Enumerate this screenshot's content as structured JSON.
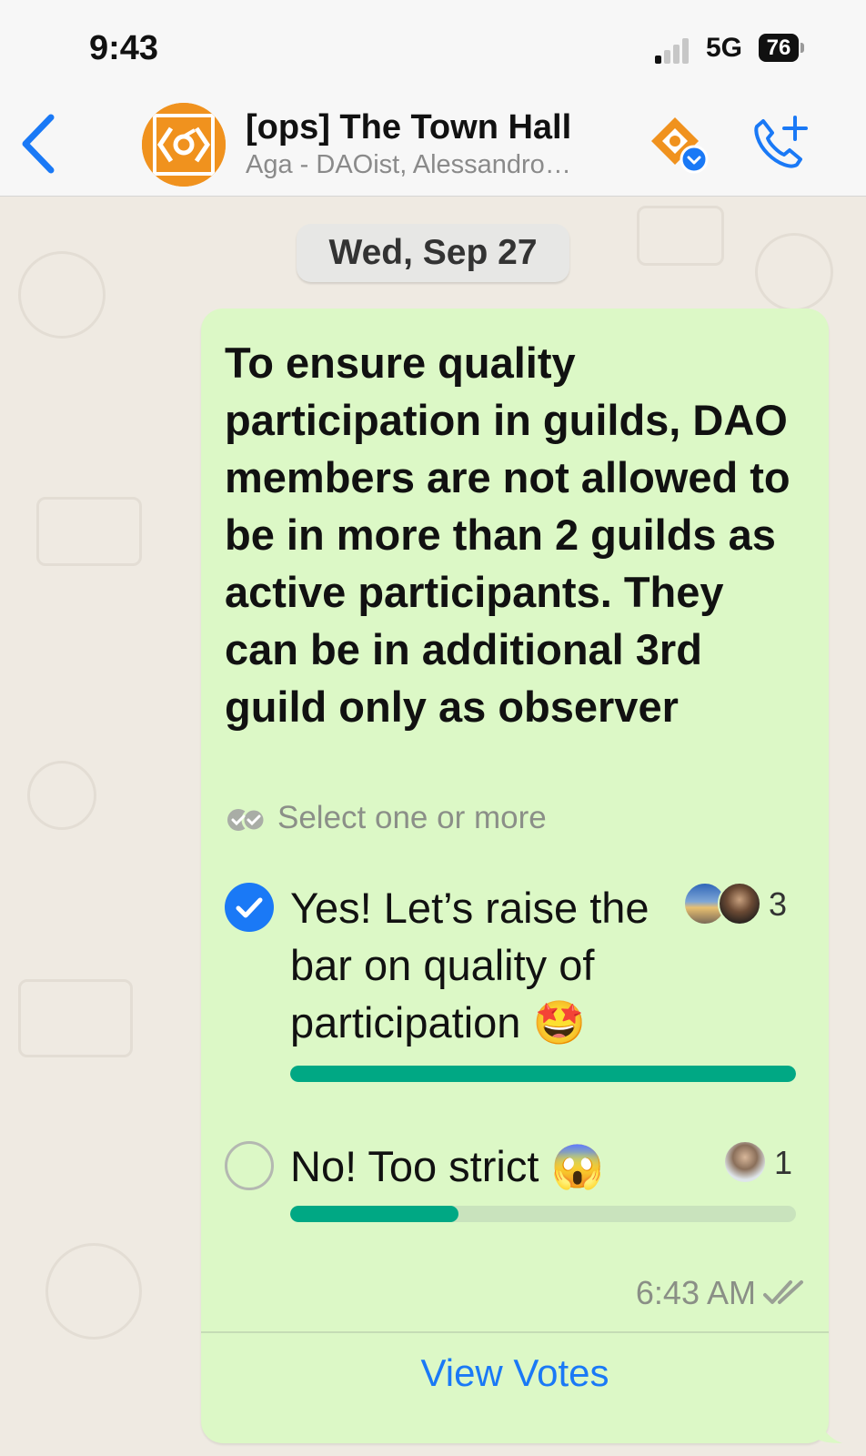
{
  "status_bar": {
    "time": "9:43",
    "network": "5G",
    "battery": "76"
  },
  "header": {
    "title": "[ops] The Town Hall",
    "subtitle": "Aga - DAOist, Alessandro…",
    "icons": [
      "back-chevron-icon",
      "group-avatar",
      "community-icon",
      "add-call-icon"
    ]
  },
  "chat": {
    "date_label": "Wed, Sep 27",
    "poll": {
      "question": "To ensure quality participation in guilds, DAO members are not allowed to be in more than 2 guilds as active participants. They can be in additional 3rd guild only as observer",
      "select_hint": "Select one or more",
      "options": [
        {
          "text": "Yes! Let’s raise the bar on quality of participation 🤩",
          "votes": "3",
          "fraction": 1.0,
          "checked": true
        },
        {
          "text": "No! Too strict 😱",
          "votes": "1",
          "fraction": 0.333,
          "checked": false
        }
      ],
      "timestamp": "6:43 AM",
      "view_votes_label": "View Votes"
    }
  },
  "colors": {
    "bubble": "#dcf8c6",
    "bar_fill": "#00a884",
    "accent_blue": "#1a79f6",
    "brand_orange": "#f0921e"
  }
}
